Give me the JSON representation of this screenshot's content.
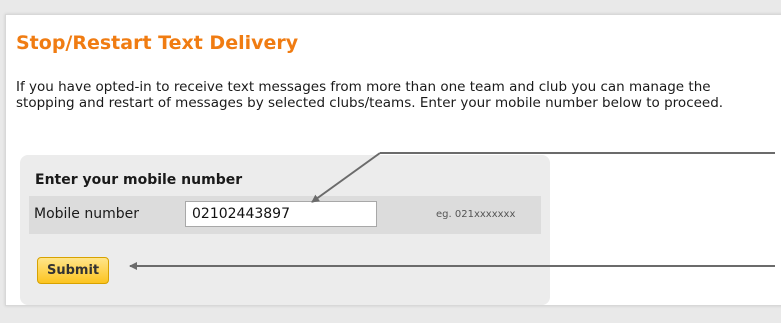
{
  "page": {
    "title": "Stop/Restart Text Delivery",
    "intro": "If you have opted-in to receive text messages from more than one team and club you can manage the stopping and restart of messages by selected clubs/teams. Enter your mobile number below to proceed."
  },
  "form": {
    "heading": "Enter your mobile number",
    "mobile_label": "Mobile number",
    "mobile_value": "02102443897",
    "hint": "eg. 021xxxxxxx",
    "submit_label": "Submit"
  },
  "colors": {
    "title": "#f07c12",
    "button": "#fcc420",
    "annotation_arrow": "#6b6b6b"
  }
}
